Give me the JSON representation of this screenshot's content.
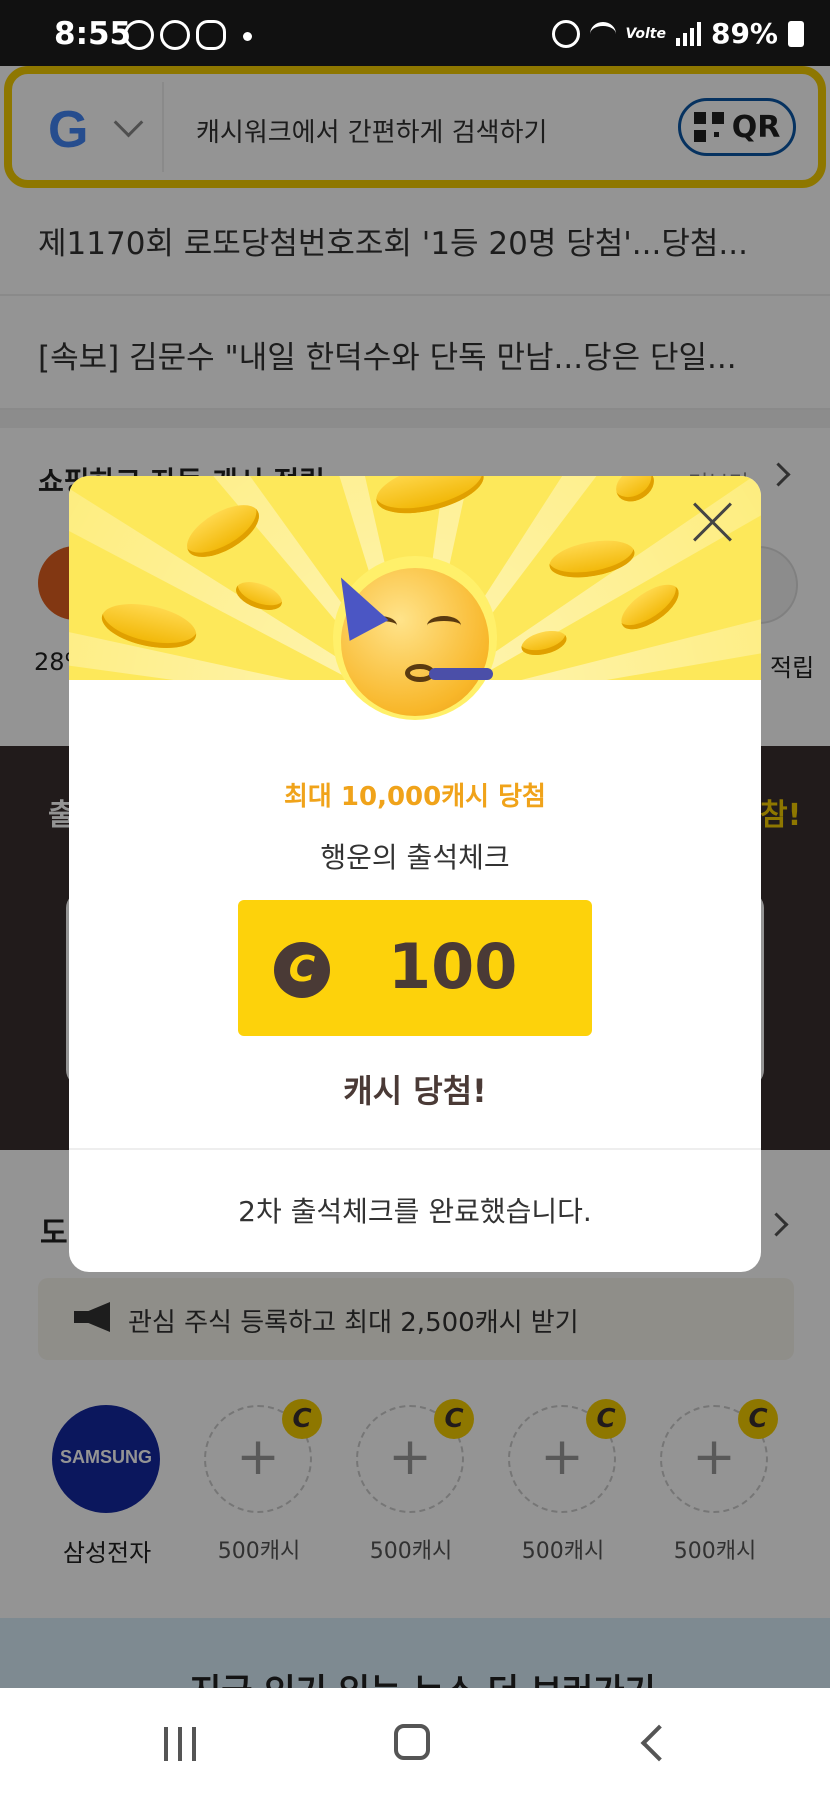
{
  "status_bar": {
    "time": "8:55",
    "network": "Volte",
    "battery": "89%"
  },
  "search": {
    "placeholder": "캐시워크에서 간편하게 검색하기",
    "qr_label": "QR",
    "logo": "G"
  },
  "news": [
    "제1170회 로또당첨번호조회 '1등 20명 당첨'...당첨...",
    "[속보] 김문수 \"내일 한덕수와 단독 만남...당은 단일..."
  ],
  "shopping": {
    "title": "쇼핑하고 자동 캐시 적립",
    "more": "더보기",
    "pct_label": "28%",
    "accum_label": "적립"
  },
  "attendance_band": {
    "left_text": "출",
    "right_text": "참!"
  },
  "stocks": {
    "title": "도",
    "notice": "관심 주식 등록하고 최대 2,500캐시 받기",
    "items": [
      {
        "name": "삼성전자",
        "logo_text": "SAMSUNG"
      },
      {
        "label": "500캐시",
        "badge": "C",
        "plus": "+"
      },
      {
        "label": "500캐시",
        "badge": "C",
        "plus": "+"
      },
      {
        "label": "500캐시",
        "badge": "C",
        "plus": "+"
      },
      {
        "label": "500캐시",
        "badge": "C",
        "plus": "+"
      }
    ]
  },
  "banner": {
    "text": "지금 인기 있는 뉴스 더 보러가기"
  },
  "modal": {
    "subtitle": "최대 10,000캐시 당첨",
    "title": "행운의 출석체크",
    "coin_symbol": "C",
    "amount": "100",
    "won_text": "캐시 당첨!",
    "done_text": "2차 출석체크를 완료했습니다."
  }
}
